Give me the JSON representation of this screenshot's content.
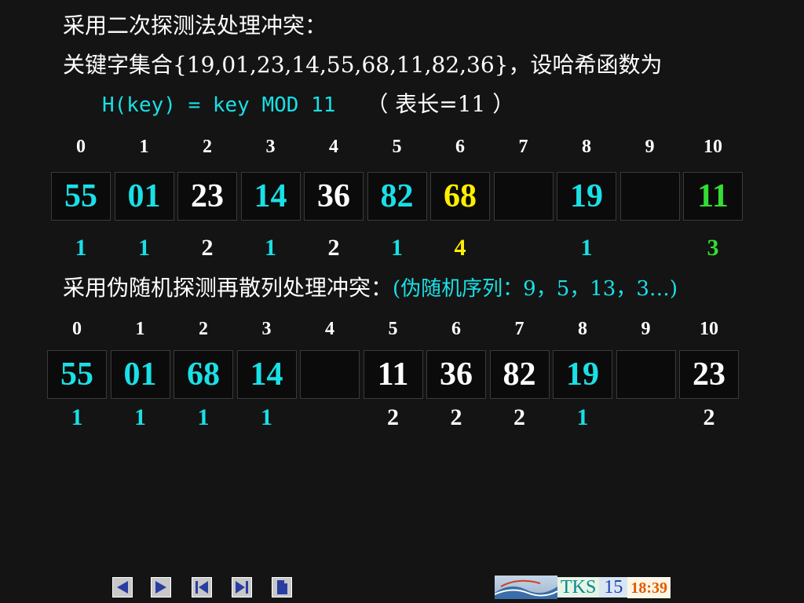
{
  "line1": "采用二次探测法处理冲突：",
  "line2": "关键字集合{19,01,23,14,55,68,11,82,36}，设哈希函数为",
  "line3": {
    "formula": "H(key) = key MOD 11",
    "table_len": "（ 表长=11 ）"
  },
  "table1": {
    "indices": [
      "0",
      "1",
      "2",
      "3",
      "4",
      "5",
      "6",
      "7",
      "8",
      "9",
      "10"
    ],
    "cells": [
      {
        "value": "55",
        "color": "#19e0e6"
      },
      {
        "value": "01",
        "color": "#19e0e6"
      },
      {
        "value": "23",
        "color": "#ffffff"
      },
      {
        "value": "14",
        "color": "#19e0e6"
      },
      {
        "value": "36",
        "color": "#ffffff"
      },
      {
        "value": "82",
        "color": "#19e0e6"
      },
      {
        "value": "68",
        "color": "#ffee00"
      },
      {
        "value": "",
        "color": "#ffffff"
      },
      {
        "value": "19",
        "color": "#19e0e6"
      },
      {
        "value": "",
        "color": "#ffffff"
      },
      {
        "value": "11",
        "color": "#33dd33"
      }
    ],
    "probes": [
      {
        "value": "1",
        "color": "#19e0e6"
      },
      {
        "value": "1",
        "color": "#19e0e6"
      },
      {
        "value": "2",
        "color": "#ffffff"
      },
      {
        "value": "1",
        "color": "#19e0e6"
      },
      {
        "value": "2",
        "color": "#ffffff"
      },
      {
        "value": "1",
        "color": "#19e0e6"
      },
      {
        "value": "4",
        "color": "#ffee00"
      },
      {
        "value": "",
        "color": "#ffffff"
      },
      {
        "value": "1",
        "color": "#19e0e6"
      },
      {
        "value": "",
        "color": "#ffffff"
      },
      {
        "value": "3",
        "color": "#33dd33"
      }
    ]
  },
  "line4": {
    "main": "采用伪随机探测再散列处理冲突：",
    "sequence": "(伪随机序列：9，5，13，3…)"
  },
  "table2": {
    "indices": [
      "0",
      "1",
      "2",
      "3",
      "4",
      "5",
      "6",
      "7",
      "8",
      "9",
      "10"
    ],
    "cells": [
      {
        "value": "55",
        "color": "#19e0e6"
      },
      {
        "value": "01",
        "color": "#19e0e6"
      },
      {
        "value": "68",
        "color": "#19e0e6"
      },
      {
        "value": "14",
        "color": "#19e0e6"
      },
      {
        "value": "",
        "color": "#ffffff"
      },
      {
        "value": "11",
        "color": "#ffffff"
      },
      {
        "value": "36",
        "color": "#ffffff"
      },
      {
        "value": "82",
        "color": "#ffffff"
      },
      {
        "value": "19",
        "color": "#19e0e6"
      },
      {
        "value": "",
        "color": "#ffffff"
      },
      {
        "value": "23",
        "color": "#ffffff"
      }
    ],
    "probes": [
      {
        "value": "1",
        "color": "#19e0e6"
      },
      {
        "value": "1",
        "color": "#19e0e6"
      },
      {
        "value": "1",
        "color": "#19e0e6"
      },
      {
        "value": "1",
        "color": "#19e0e6"
      },
      {
        "value": "",
        "color": "#ffffff"
      },
      {
        "value": "2",
        "color": "#ffffff"
      },
      {
        "value": "2",
        "color": "#ffffff"
      },
      {
        "value": "2",
        "color": "#ffffff"
      },
      {
        "value": "1",
        "color": "#19e0e6"
      },
      {
        "value": "",
        "color": "#ffffff"
      },
      {
        "value": "2",
        "color": "#ffffff"
      }
    ]
  },
  "footer": {
    "nav_icons": [
      "prev-arrow-icon",
      "next-arrow-icon",
      "first-page-icon",
      "last-page-icon",
      "document-icon"
    ],
    "tks_label": "TKS",
    "page_number": "15",
    "time": "18:39"
  }
}
